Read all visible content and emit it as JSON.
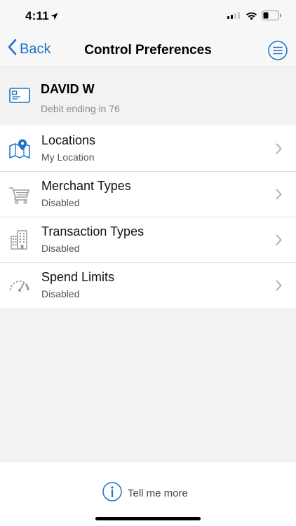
{
  "status_bar": {
    "time": "4:11"
  },
  "nav": {
    "back_label": "Back",
    "title": "Control Preferences"
  },
  "card": {
    "name": "DAVID W",
    "subtitle": "Debit ending in 76"
  },
  "preferences": [
    {
      "title": "Locations",
      "status": "My Location",
      "icon": "map-pin-icon"
    },
    {
      "title": "Merchant Types",
      "status": "Disabled",
      "icon": "cart-icon"
    },
    {
      "title": "Transaction Types",
      "status": "Disabled",
      "icon": "buildings-icon"
    },
    {
      "title": "Spend Limits",
      "status": "Disabled",
      "icon": "gauge-icon"
    }
  ],
  "footer": {
    "tell_more_label": "Tell me more"
  },
  "colors": {
    "accent": "#1a73c8",
    "icon_gray": "#9a9a9a",
    "background": "#f2f2f2"
  }
}
